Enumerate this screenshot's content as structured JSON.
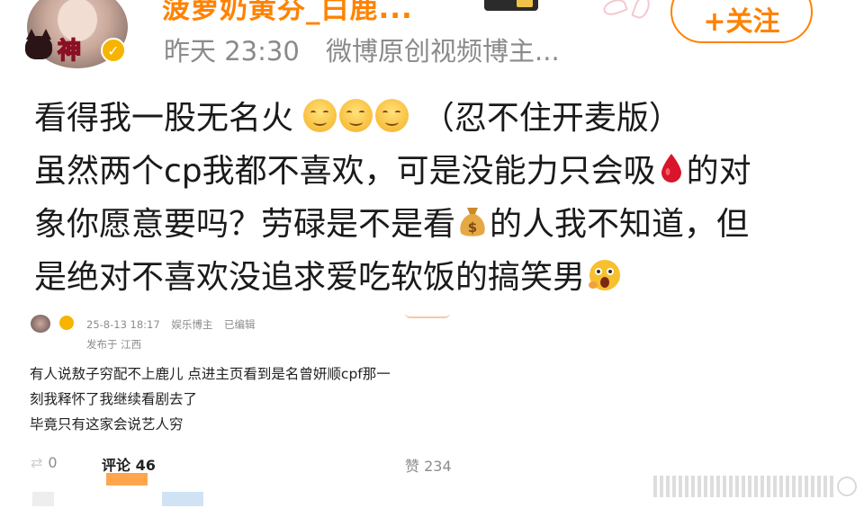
{
  "header": {
    "username": "菠萝奶黄芬_白鹿...",
    "avatar_frame_text": "神",
    "follow_label": "+关注",
    "time": "昨天 23:30",
    "source": "微博原创视频博主..."
  },
  "post": {
    "line1": "看得我一股无名火",
    "line1_suffix": "（忍不住开麦版）",
    "line2_prefix": "虽然两个cp我都不喜欢，可是没能力只会吸",
    "line2_suffix": "的对",
    "line3_prefix": "象你愿意要吗？劳碌是不是看",
    "line3_suffix": "的人我不知道，但",
    "line4": "是绝对不喜欢没追求爱吃软饭的搞笑男"
  },
  "embed": {
    "date": "25-8-13 18:17",
    "role": "娱乐博主",
    "edited": "已编辑",
    "location": "发布于 江西",
    "lines": [
      "有人说敖子穷配不上鹿儿 点进主页看到是名曾妍顺cpf那一",
      "刻我释怀了我继续看剧去了",
      "毕竟只有这家会说艺人穷"
    ],
    "repost_count": "0",
    "comment_label": "评论 46",
    "like_label": "赞 234"
  },
  "icons": {
    "smile": "smiling-face-icon",
    "blood": "blood-drop-icon",
    "money": "money-bag-icon",
    "shock": "shocked-face-icon",
    "verify": "verified-badge-icon"
  },
  "colors": {
    "accent": "#ff8200",
    "meta": "#8a8a8a",
    "text": "#1a1a1a"
  }
}
